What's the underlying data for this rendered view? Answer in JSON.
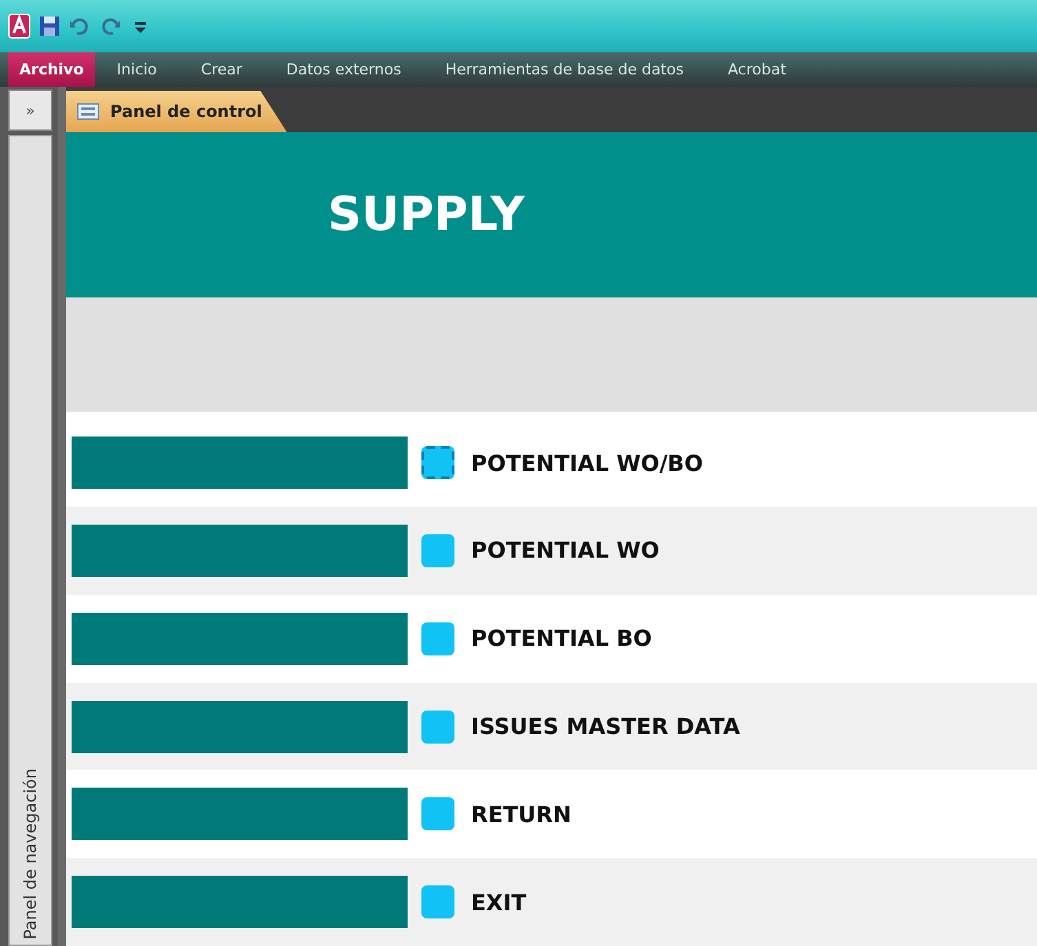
{
  "ribbon_tabs": [
    {
      "label": "Archivo",
      "selected": true
    },
    {
      "label": "Inicio",
      "selected": false
    },
    {
      "label": "Crear",
      "selected": false
    },
    {
      "label": "Datos externos",
      "selected": false
    },
    {
      "label": "Herramientas de base de datos",
      "selected": false
    },
    {
      "label": "Acrobat",
      "selected": false
    }
  ],
  "navigation_pane": {
    "toggle": "»",
    "label": "Panel de navegación"
  },
  "document_tabs": [
    {
      "label": "Panel de control",
      "selected": true
    }
  ],
  "form": {
    "title": "SUPPLY",
    "items": [
      {
        "label": "POTENTIAL WO/BO",
        "focused": true
      },
      {
        "label": "POTENTIAL WO",
        "focused": false
      },
      {
        "label": "POTENTIAL BO",
        "focused": false
      },
      {
        "label": "ISSUES MASTER DATA",
        "focused": false
      },
      {
        "label": "RETURN",
        "focused": false
      },
      {
        "label": "EXIT",
        "focused": false
      }
    ]
  }
}
